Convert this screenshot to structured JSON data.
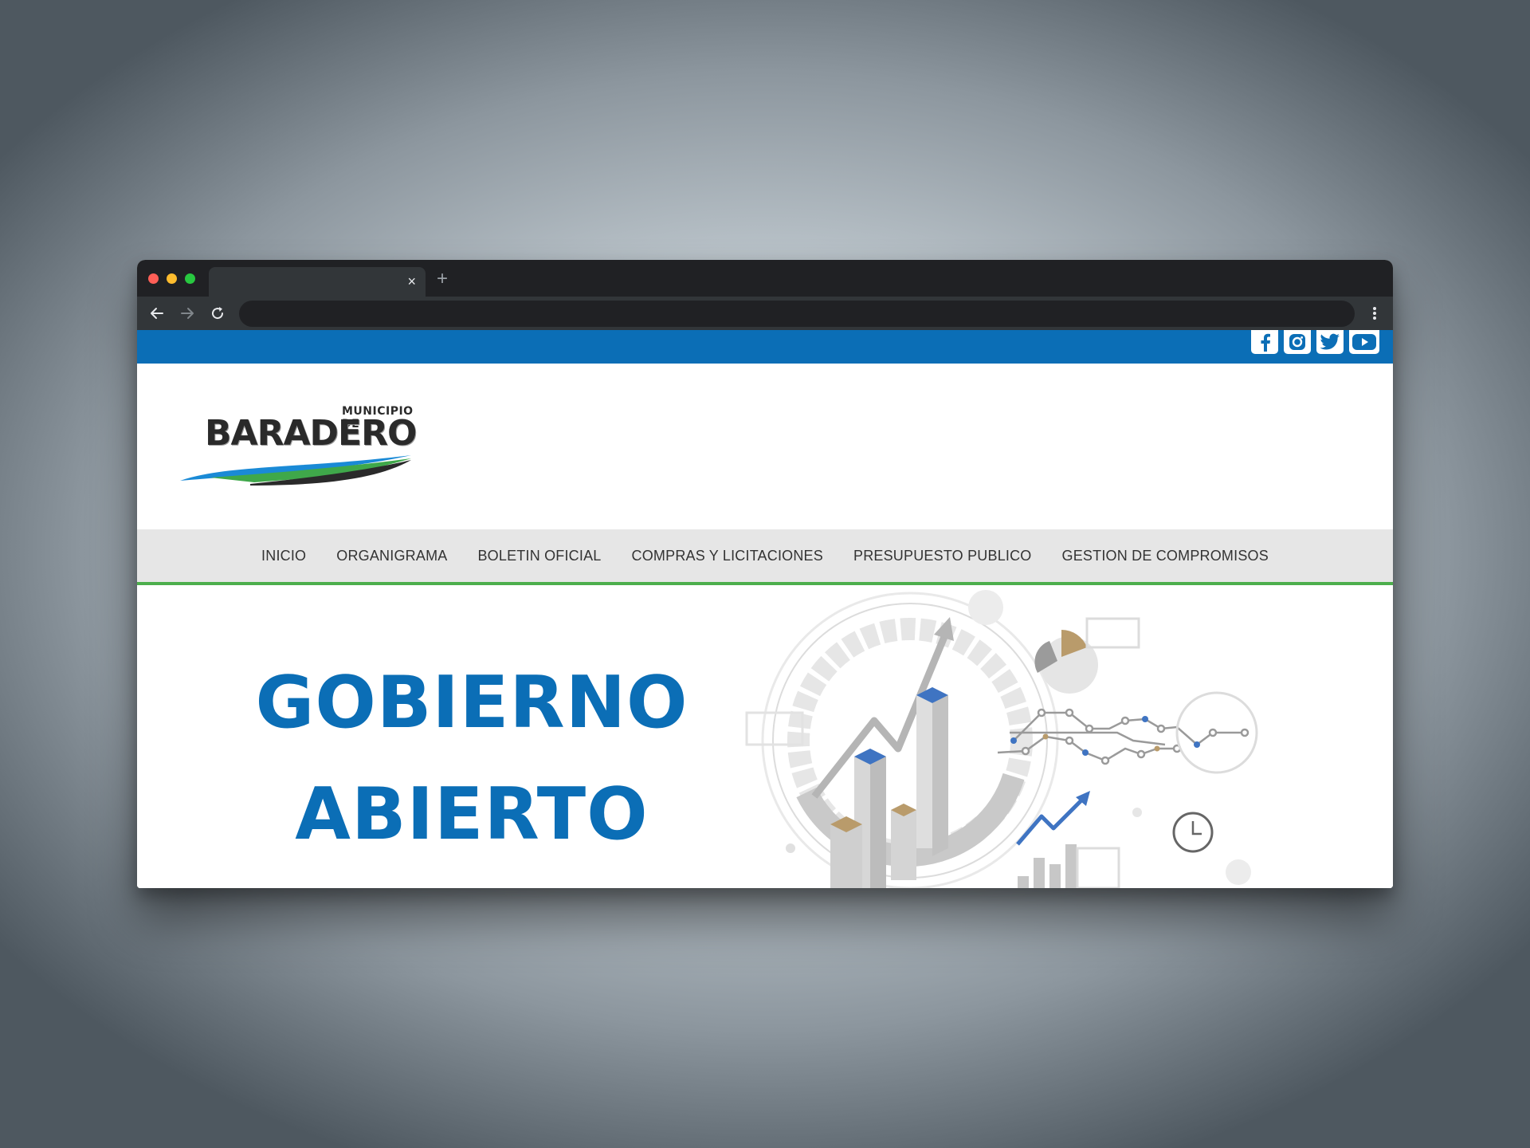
{
  "browser": {
    "tab_close": "×",
    "new_tab": "+"
  },
  "social": {
    "icons": [
      "facebook-icon",
      "instagram-icon",
      "twitter-icon",
      "youtube-icon"
    ]
  },
  "logo": {
    "small_text": "MUNICIPIO DE",
    "big_text": "BARADERO"
  },
  "nav": {
    "items": [
      "INICIO",
      "ORGANIGRAMA",
      "BOLETIN OFICIAL",
      "COMPRAS Y LICITACIONES",
      "PRESUPUESTO PUBLICO",
      "GESTION DE COMPROMISOS"
    ]
  },
  "hero": {
    "line1": "GOBIERNO",
    "line2": "ABIERTO"
  },
  "colors": {
    "brand_blue": "#0b6eb6",
    "accent_green": "#4cae4c",
    "nav_bg": "#e6e6e6"
  }
}
